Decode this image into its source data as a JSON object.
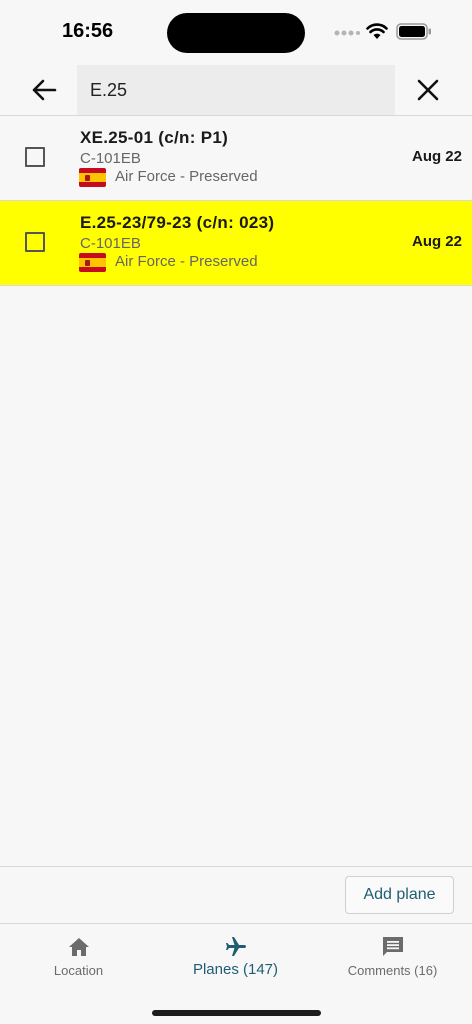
{
  "status_bar": {
    "time": "16:56"
  },
  "search": {
    "query": "E.25"
  },
  "planes": [
    {
      "registration": "XE.25-01 (c/n: P1)",
      "type": "C-101EB",
      "country_flag": "spain-flag",
      "operator": "Air Force - Preserved",
      "date": "Aug 22",
      "highlighted": false
    },
    {
      "registration": "E.25-23/79-23 (c/n: 023)",
      "type": "C-101EB",
      "country_flag": "spain-flag",
      "operator": "Air Force - Preserved",
      "date": "Aug 22",
      "highlighted": true
    }
  ],
  "actions": {
    "add_plane_label": "Add plane"
  },
  "tabs": [
    {
      "label": "Location",
      "icon": "home-icon",
      "active": false
    },
    {
      "label": "Planes (147)",
      "icon": "airplane-icon",
      "active": true
    },
    {
      "label": "Comments (16)",
      "icon": "comment-icon",
      "active": false
    }
  ],
  "colors": {
    "highlight": "#ffff00",
    "accent": "#1f5d73"
  }
}
